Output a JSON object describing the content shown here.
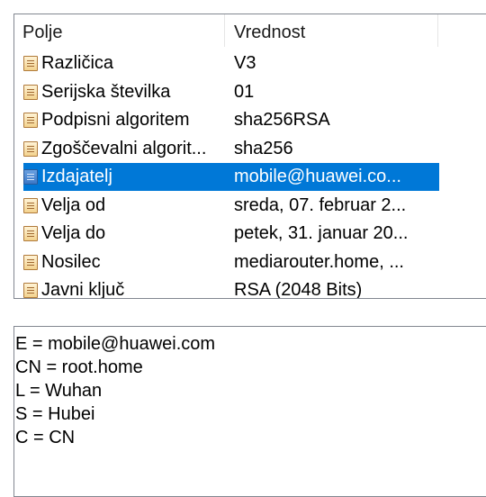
{
  "list": {
    "columns": {
      "field": "Polje",
      "value": "Vrednost"
    },
    "rows": [
      {
        "field": "Različica",
        "value": "V3",
        "selected": false
      },
      {
        "field": "Serijska številka",
        "value": "01",
        "selected": false
      },
      {
        "field": "Podpisni algoritem",
        "value": "sha256RSA",
        "selected": false
      },
      {
        "field": "Zgoščevalni algorit...",
        "value": "sha256",
        "selected": false
      },
      {
        "field": "Izdajatelj",
        "value": "mobile@huawei.co...",
        "selected": true
      },
      {
        "field": "Velja od",
        "value": "sreda, 07. februar 2...",
        "selected": false
      },
      {
        "field": "Velja do",
        "value": "petek, 31. januar 20...",
        "selected": false
      },
      {
        "field": "Nosilec",
        "value": "mediarouter.home, ...",
        "selected": false
      },
      {
        "field": "Javni ključ",
        "value": "RSA (2048 Bits)",
        "selected": false
      }
    ]
  },
  "detail": {
    "lines": [
      "E = mobile@huawei.com",
      "CN = root.home",
      "L = Wuhan",
      "S = Hubei",
      "C = CN"
    ]
  },
  "colors": {
    "selection": "#0078d7",
    "border": "#828790"
  }
}
